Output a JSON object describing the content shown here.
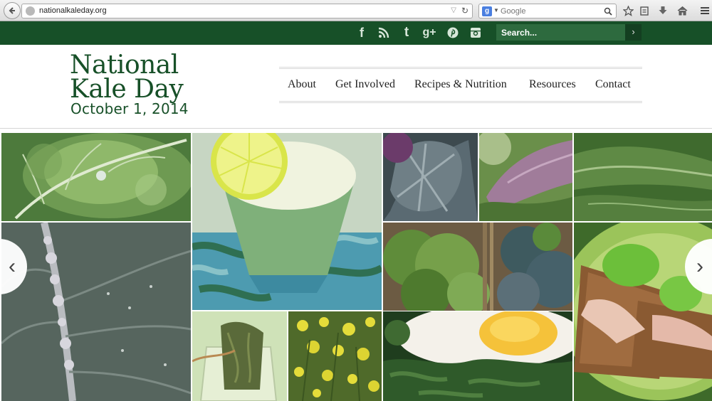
{
  "browser": {
    "url": "nationalkaleday.org",
    "search_engine_placeholder": "Google",
    "search_engine_logo": "g"
  },
  "icons": {
    "back": "back-arrow-icon",
    "globe": "globe-icon",
    "reload": "reload-icon",
    "star": "bookmark-star-icon",
    "clipboard": "bookmarks-list-icon",
    "download": "download-icon",
    "home": "home-icon",
    "menu": "menu-icon"
  },
  "topbar": {
    "search_placeholder": "Search...",
    "search_go": "›",
    "social": {
      "facebook": "f",
      "twitter": "t",
      "googleplus": "g+"
    }
  },
  "logo": {
    "line1": "National",
    "line2": "Kale Day",
    "line3": "October 1, 2014"
  },
  "nav": {
    "items": [
      "About",
      "Get Involved",
      "Recipes & Nutrition",
      "Resources",
      "Contact"
    ]
  },
  "slider": {
    "prev": "‹",
    "next": "›"
  },
  "colors": {
    "brand_green": "#175028",
    "search_box": "#2d6a3e"
  }
}
